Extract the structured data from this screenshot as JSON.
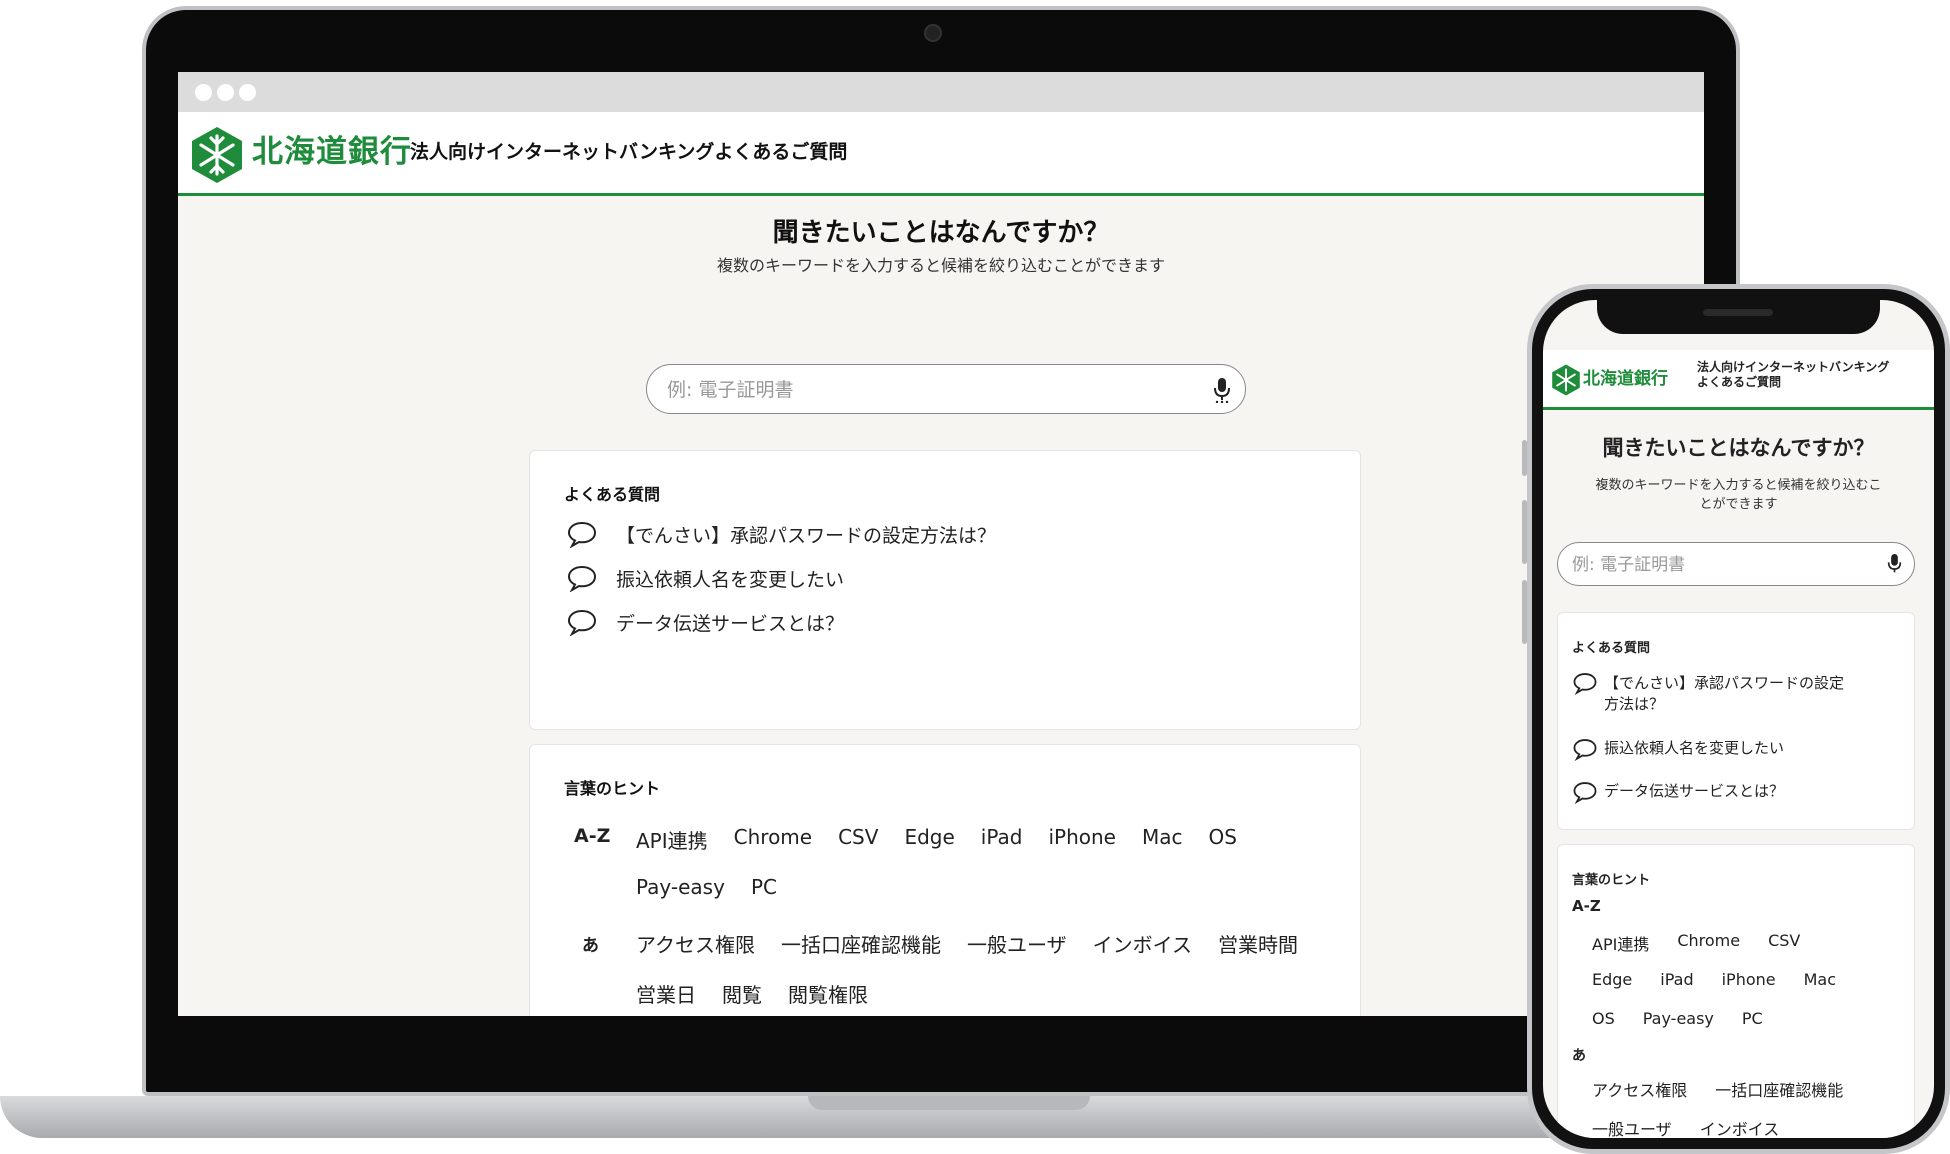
{
  "brand": {
    "logo_text": "北海道銀行",
    "accent_color": "#1e8c3a"
  },
  "header": {
    "title": "法人向けインターネットバンキングよくあるご質問",
    "title_mobile_line1": "法人向けインターネットバンキング",
    "title_mobile_line2": "よくあるご質問"
  },
  "hero": {
    "title": "聞きたいことはなんですか？",
    "subtitle": "複数のキーワードを入力すると候補を絞り込むことができます",
    "subtitle_mobile_line1": "複数のキーワードを入力すると候補を絞り込むこ",
    "subtitle_mobile_line2": "とができます"
  },
  "search": {
    "placeholder": "例: 電子証明書",
    "mic_icon": "microphone-icon"
  },
  "faq": {
    "title": "よくある質問",
    "items": [
      "【でんさい】承認パスワードの設定方法は？",
      "振込依頼人名を変更したい",
      "データ伝送サービスとは？"
    ],
    "item_mobile_wrap": [
      "【でんさい】承認パスワードの設定",
      "方法は？"
    ]
  },
  "hints": {
    "title": "言葉のヒント",
    "groups": [
      {
        "label": "A-Z",
        "words": [
          "API連携",
          "Chrome",
          "CSV",
          "Edge",
          "iPad",
          "iPhone",
          "Mac",
          "OS",
          "Pay-easy",
          "PC"
        ]
      },
      {
        "label": "あ",
        "words": [
          "アクセス権限",
          "一括口座確認機能",
          "一般ユーザ",
          "インボイス",
          "営業時間",
          "営業日",
          "閲覧",
          "閲覧権限"
        ]
      }
    ]
  }
}
